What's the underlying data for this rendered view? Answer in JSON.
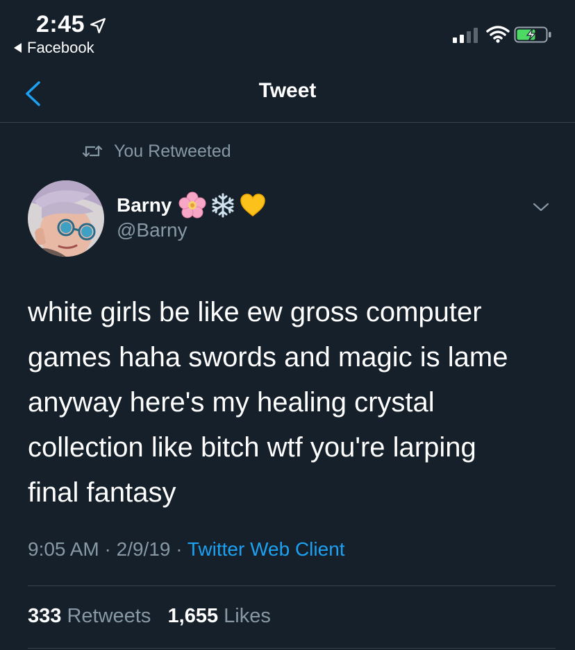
{
  "status_bar": {
    "time": "2:45",
    "back_app": "Facebook",
    "icons": [
      "location-arrow-icon",
      "signal-icon",
      "wifi-icon",
      "battery-charging-icon"
    ]
  },
  "nav": {
    "title": "Tweet",
    "back_icon": "chevron-left-icon"
  },
  "retweet_label": "You Retweeted",
  "author": {
    "display_name": "Barny",
    "emojis": [
      "cherry-blossom-icon",
      "snowflake-icon",
      "yellow-heart-icon"
    ],
    "handle": "@Barny"
  },
  "tweet": {
    "lines": [
      "white girls be like ew gross computer",
      "games haha swords and magic is lame",
      "anyway here's my healing crystal",
      "collection like bitch wtf you're larping",
      "final fantasy"
    ],
    "time": "9:05 AM",
    "date": "2/9/19",
    "client": "Twitter Web Client"
  },
  "stats": {
    "retweets_count": "333",
    "retweets_label": "Retweets",
    "likes_count": "1,655",
    "likes_label": "Likes"
  },
  "colors": {
    "background": "#15202b",
    "secondary_text": "#8899a6",
    "accent": "#1da1f2",
    "divider": "#38444d"
  }
}
